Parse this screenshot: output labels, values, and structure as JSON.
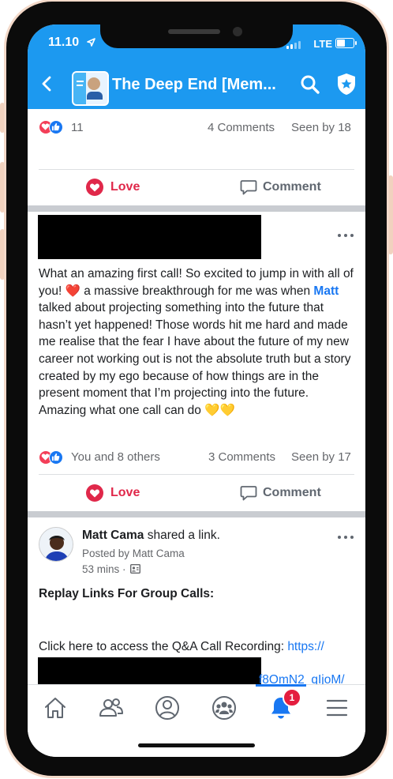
{
  "status_bar": {
    "time": "11.10",
    "network": "LTE"
  },
  "header": {
    "title": "The Deep End [Mem...",
    "group_logo_text": "THE DEEP END"
  },
  "post1": {
    "reaction_count": "11",
    "comments": "4 Comments",
    "seen": "Seen by 18",
    "love_label": "Love",
    "comment_label": "Comment"
  },
  "post2": {
    "text_before": "What an amazing first call! So excited to jump in with all of you! ❤️ a massive breakthrough for me was when ",
    "mention": "Matt",
    "text_after": " talked about projecting something into the future that hasn’t yet happened! Those words hit me hard and made me realise that the fear I have about the future of my new career not working out is not the absolute truth but a story created by my ego because of how things are in the present moment that I’m projecting into the future. Amazing what one call can do 💛💛",
    "reactors": "You and 8 others",
    "comments": "3 Comments",
    "seen": "Seen by 17",
    "love_label": "Love",
    "comment_label": "Comment"
  },
  "post3": {
    "author": "Matt Cama",
    "action": "shared a link.",
    "posted_by": "Posted by Matt Cama",
    "time": "53 mins ·",
    "heading": "Replay Links For Group Calls:",
    "link_intro": "Click here to access the Q&A Call Recording: ",
    "link_start": "https://",
    "link_end": "f8OmN2_qIjoM/"
  },
  "tabbar": {
    "tabs": [
      "home",
      "groups",
      "profile",
      "communities",
      "notifications",
      "menu"
    ],
    "notification_badge": "1",
    "active_tab": "notifications"
  },
  "colors": {
    "header_blue": "#1c99f0",
    "love_red": "#e0284a",
    "link_blue": "#1877f2"
  }
}
